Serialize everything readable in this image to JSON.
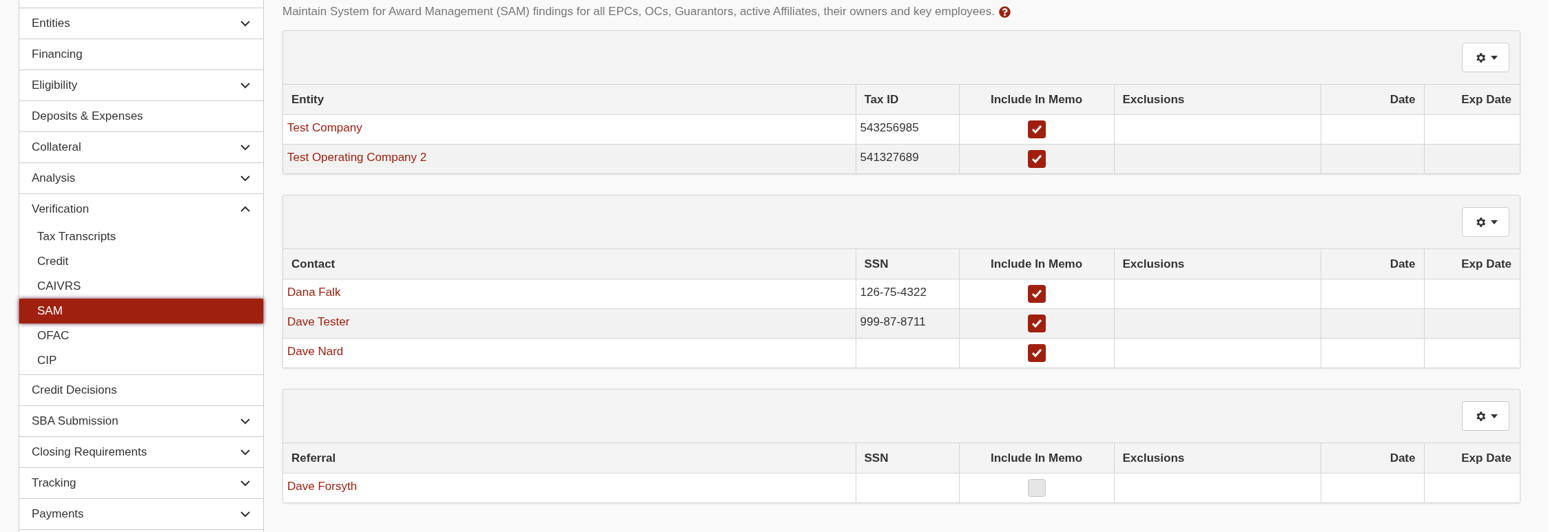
{
  "sidebar": {
    "items": [
      {
        "label": "Entities",
        "kind": "group",
        "expanded": false
      },
      {
        "label": "Financing",
        "kind": "link"
      },
      {
        "label": "Eligibility",
        "kind": "group",
        "expanded": false
      },
      {
        "label": "Deposits & Expenses",
        "kind": "link"
      },
      {
        "label": "Collateral",
        "kind": "group",
        "expanded": false
      },
      {
        "label": "Analysis",
        "kind": "group",
        "expanded": false
      },
      {
        "label": "Verification",
        "kind": "group",
        "expanded": true,
        "children": [
          {
            "label": "Tax Transcripts",
            "selected": false
          },
          {
            "label": "Credit",
            "selected": false
          },
          {
            "label": "CAIVRS",
            "selected": false
          },
          {
            "label": "SAM",
            "selected": true
          },
          {
            "label": "OFAC",
            "selected": false
          },
          {
            "label": "CIP",
            "selected": false
          }
        ]
      },
      {
        "label": "Credit Decisions",
        "kind": "link"
      },
      {
        "label": "SBA Submission",
        "kind": "group",
        "expanded": false
      },
      {
        "label": "Closing Requirements",
        "kind": "group",
        "expanded": false
      },
      {
        "label": "Tracking",
        "kind": "group",
        "expanded": false
      },
      {
        "label": "Payments",
        "kind": "group",
        "expanded": false
      }
    ]
  },
  "intro": "Maintain System for Award Management (SAM) findings for all EPCs, OCs, Guarantors, active Affiliates, their owners and key employees.",
  "panels": [
    {
      "columns": [
        "Entity",
        "Tax ID",
        "Include In Memo",
        "Exclusions",
        "Date",
        "Exp Date"
      ],
      "rows": [
        {
          "name": "Test Company",
          "id": "543256985",
          "include": true
        },
        {
          "name": "Test Operating Company 2",
          "id": "541327689",
          "include": true
        }
      ]
    },
    {
      "columns": [
        "Contact",
        "SSN",
        "Include In Memo",
        "Exclusions",
        "Date",
        "Exp Date"
      ],
      "rows": [
        {
          "name": "Dana Falk",
          "id": "126-75-4322",
          "include": true
        },
        {
          "name": "Dave Tester",
          "id": "999-87-8711",
          "include": true
        },
        {
          "name": "Dave Nard",
          "include": true
        }
      ]
    },
    {
      "columns": [
        "Referral",
        "SSN",
        "Include In Memo",
        "Exclusions",
        "Date",
        "Exp Date"
      ],
      "rows": [
        {
          "name": "Dave Forsyth",
          "include": false
        }
      ]
    }
  ]
}
